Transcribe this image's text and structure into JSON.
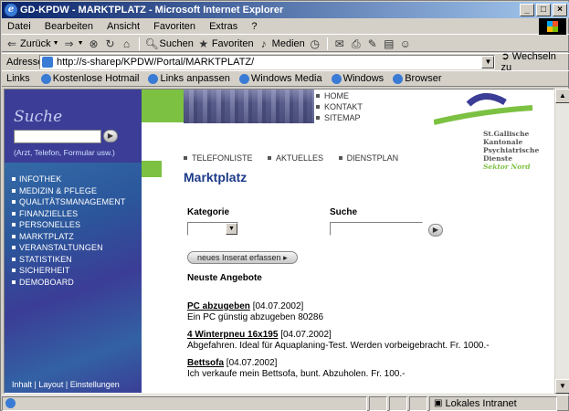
{
  "window": {
    "title": "GD-KPDW - MARKTPLATZ - Microsoft Internet Explorer"
  },
  "menubar": [
    "Datei",
    "Bearbeiten",
    "Ansicht",
    "Favoriten",
    "Extras",
    "?"
  ],
  "toolbar": {
    "back": "Zurück",
    "search": "Suchen",
    "favorites": "Favoriten",
    "media": "Medien"
  },
  "address": {
    "label": "Adresse",
    "url": "http://s-sharep/KPDW/Portal/MARKTPLATZ/",
    "go": "Wechseln zu"
  },
  "links": {
    "label": "Links",
    "items": [
      "Kostenlose Hotmail",
      "Links anpassen",
      "Windows Media",
      "Windows",
      "Browser"
    ]
  },
  "sidebar": {
    "search_title": "Suche",
    "search_hint": "(Arzt, Telefon, Formular usw.)",
    "nav": [
      "INFOTHEK",
      "MEDIZIN & PFLEGE",
      "QUALITÄTSMANAGEMENT",
      "FINANZIELLES",
      "PERSONELLES",
      "MARKTPLATZ",
      "VERANSTALTUNGEN",
      "STATISTIKEN",
      "SICHERHEIT",
      "DEMOBOARD"
    ],
    "footer": "Inhalt | Layout | Einstellungen"
  },
  "topnav": [
    "HOME",
    "KONTAKT",
    "SITEMAP"
  ],
  "logo": {
    "lines": [
      "St.Gallische",
      "Kantonale",
      "Psychiatrische",
      "Dienste"
    ],
    "sector": "Sektor Nord"
  },
  "subnav": [
    "TELEFONLISTE",
    "AKTUELLES",
    "DIENSTPLAN"
  ],
  "main": {
    "heading": "Marktplatz",
    "kategorie_label": "Kategorie",
    "suche_label": "Suche",
    "new_button": "neues Inserat erfassen",
    "newest_label": "Neuste Angebote",
    "offers": [
      {
        "title": "PC abzugeben",
        "date": "[04.07.2002]",
        "desc": "Ein PC günstig abzugeben 80286"
      },
      {
        "title": "4 Winterpneu 16x195",
        "date": "[04.07.2002]",
        "desc": "Abgefahren. Ideal für Aquaplaning-Test. Werden vorbeigebracht. Fr. 1000.-"
      },
      {
        "title": "Bettsofa",
        "date": "[04.07.2002]",
        "desc": "Ich verkaufe mein Bettsofa, bunt. Abzuholen. Fr. 100.-"
      }
    ]
  },
  "status": {
    "zone": "Lokales Intranet"
  },
  "colors": {
    "sidebar": "#3b3d96",
    "accent_green": "#7cc142",
    "heading_blue": "#1d3a8a"
  }
}
